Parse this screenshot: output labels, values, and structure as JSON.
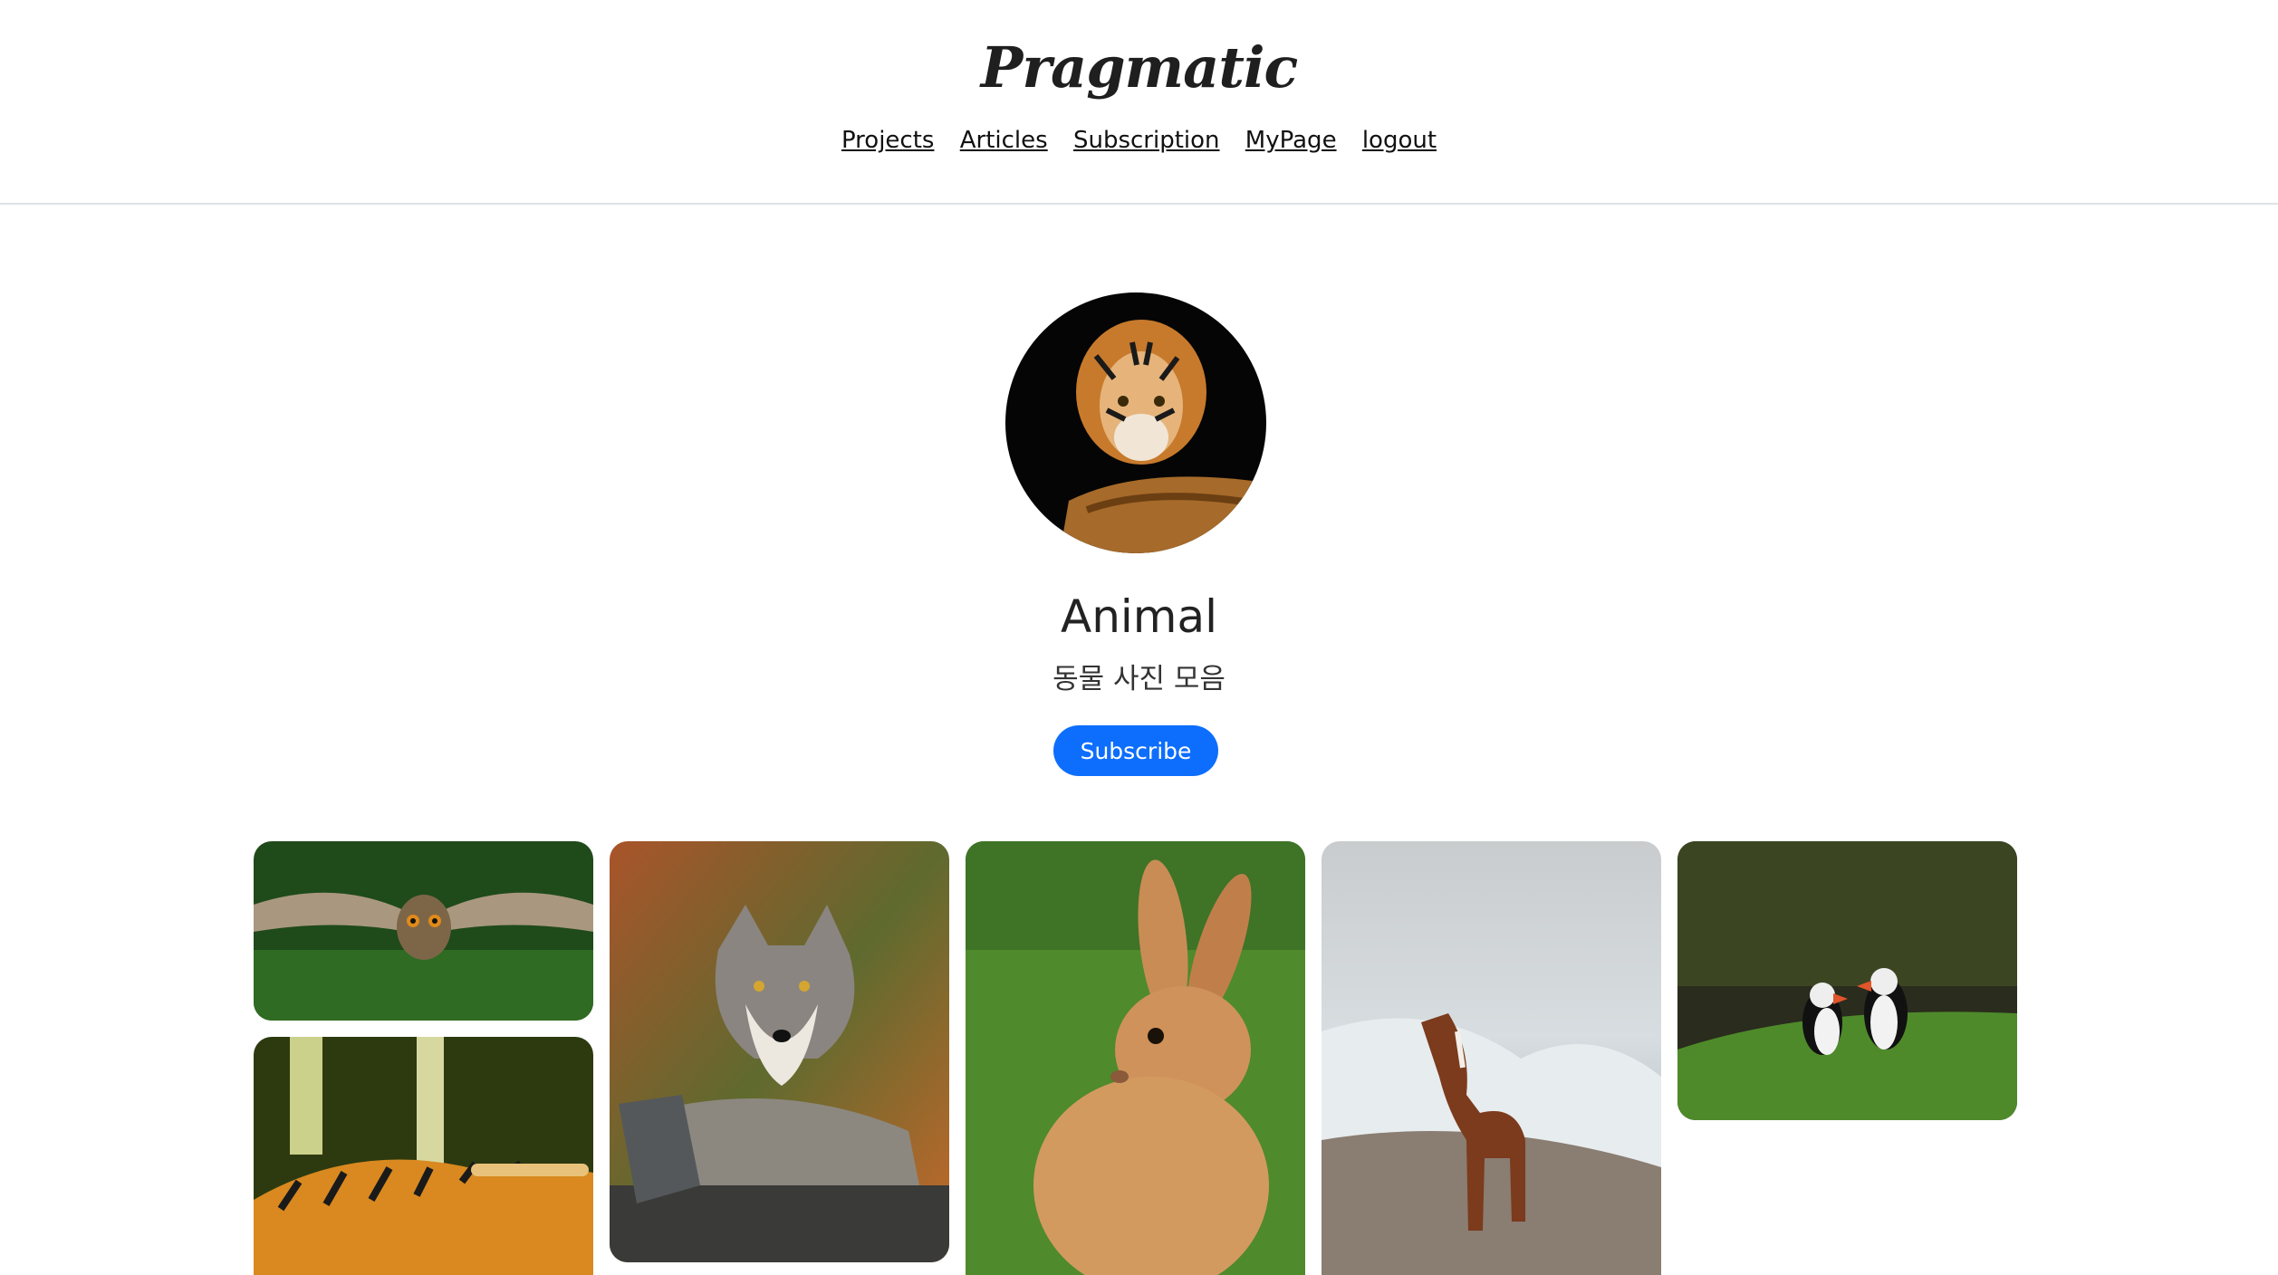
{
  "header": {
    "logo": "Pragmatic",
    "nav": [
      "Projects",
      "Articles",
      "Subscription",
      "MyPage",
      "logout"
    ]
  },
  "project": {
    "title": "Animal",
    "description": "동물 사진 모음",
    "subscribe_label": "Subscribe"
  },
  "colors": {
    "accent": "#0d6efd",
    "divider": "#dee2e6"
  },
  "images": [
    {
      "name": "owl-photo"
    },
    {
      "name": "tiger-photo"
    },
    {
      "name": "wolf-photo"
    },
    {
      "name": "rabbit-photo"
    },
    {
      "name": "horse-photo"
    },
    {
      "name": "puffins-photo"
    }
  ]
}
